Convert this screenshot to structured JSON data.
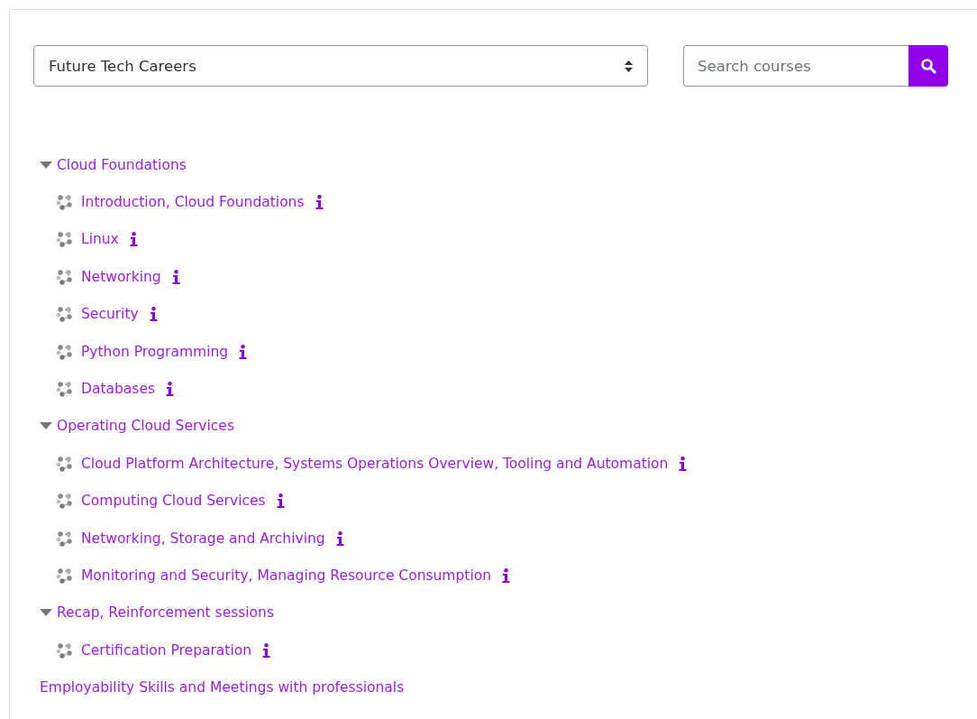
{
  "category_select": {
    "value": "Future Tech Careers"
  },
  "search": {
    "placeholder": "Search courses"
  },
  "categories": [
    {
      "kind": "category",
      "name": "Cloud Foundations",
      "expanded": true,
      "courses": [
        "Introduction, Cloud Foundations",
        "Linux",
        "Networking",
        "Security",
        "Python Programming",
        "Databases"
      ]
    },
    {
      "kind": "category",
      "name": "Operating Cloud Services",
      "expanded": true,
      "courses": [
        "Cloud Platform Architecture, Systems Operations Overview, Tooling and Automation",
        "Computing Cloud Services",
        "Networking, Storage and Archiving",
        "Monitoring and Security, Managing Resource Consumption"
      ]
    },
    {
      "kind": "category",
      "name": "Recap, Reinforcement sessions",
      "expanded": true,
      "courses": [
        "Certification Preparation"
      ]
    },
    {
      "kind": "empty",
      "name": "Employability Skills and Meetings with professionals"
    }
  ]
}
